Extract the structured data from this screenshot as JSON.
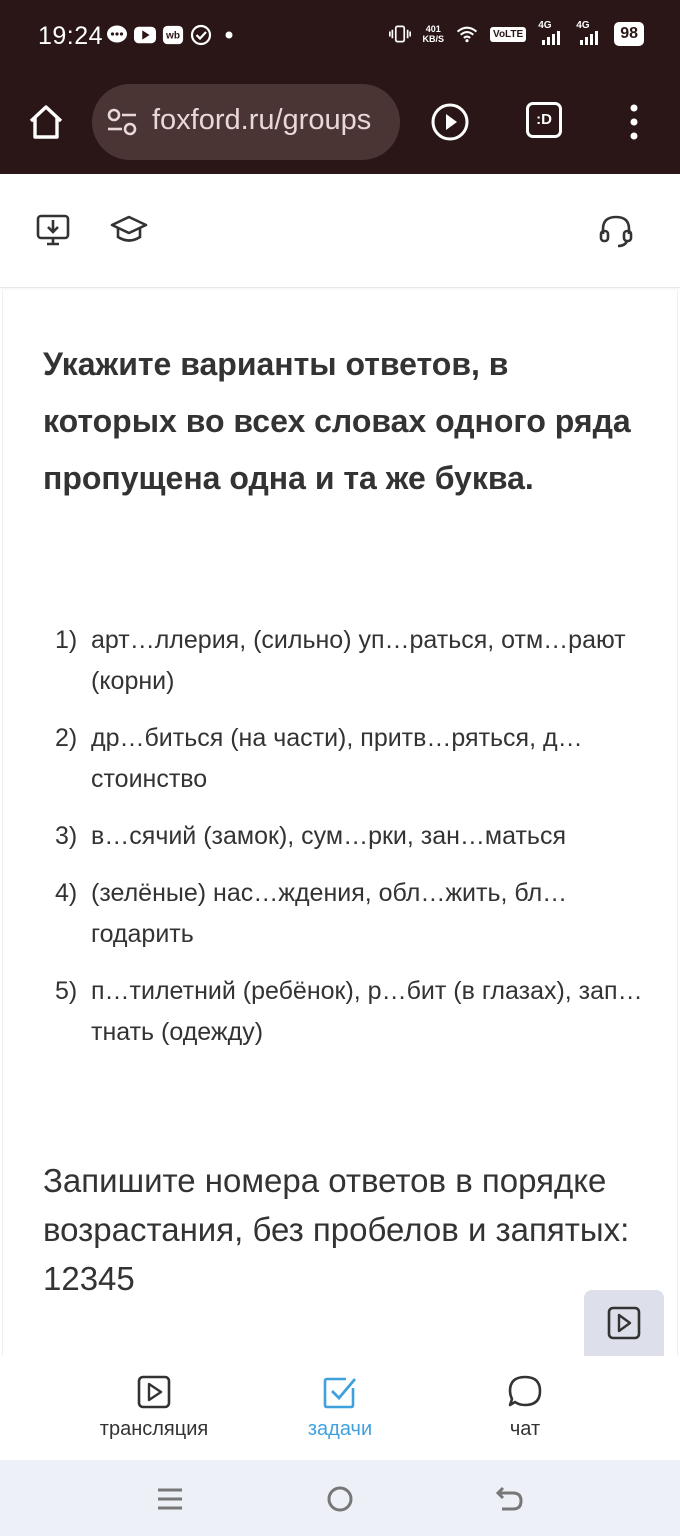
{
  "status_bar": {
    "time": "19:24",
    "net_speed_value": "401",
    "net_speed_unit": "KB/S",
    "volte": "VoLTE",
    "sim1": "4G",
    "sim2": "4G",
    "battery": "98"
  },
  "browser": {
    "url": "foxford.ru/groups",
    "ext_label": ":D"
  },
  "task": {
    "title": "Укажите варианты ответов, в которых во всех словах одного ряда пропущена одна и та же буква.",
    "options": [
      {
        "num": "1)",
        "text": "арт…ллерия, (сильно) уп…раться, отм…рают (корни)"
      },
      {
        "num": "2)",
        "text": "др…биться (на части), притв…ряться, д…стоинство"
      },
      {
        "num": "3)",
        "text": "в…сячий (замок), сум…рки, зан…маться"
      },
      {
        "num": "4)",
        "text": "(зелёные) нас…ждения, обл…жить, бл…годарить"
      },
      {
        "num": "5)",
        "text": "п…тилетний (ребёнок), р…бит (в глазах), зап…тнать (одежду)"
      }
    ],
    "instruction": "Запишите номера ответов в порядке возрастания, без пробелов и запятых: 12345"
  },
  "bottom_nav": {
    "items": [
      {
        "label": "трансляция",
        "icon": "play-square-icon",
        "active": false
      },
      {
        "label": "задачи",
        "icon": "checkbox-icon",
        "active": true
      },
      {
        "label": "чат",
        "icon": "chat-bubble-icon",
        "active": false
      }
    ]
  },
  "colors": {
    "browser_bg": "#2a1616",
    "accent": "#3fa0de",
    "text": "#333333"
  }
}
